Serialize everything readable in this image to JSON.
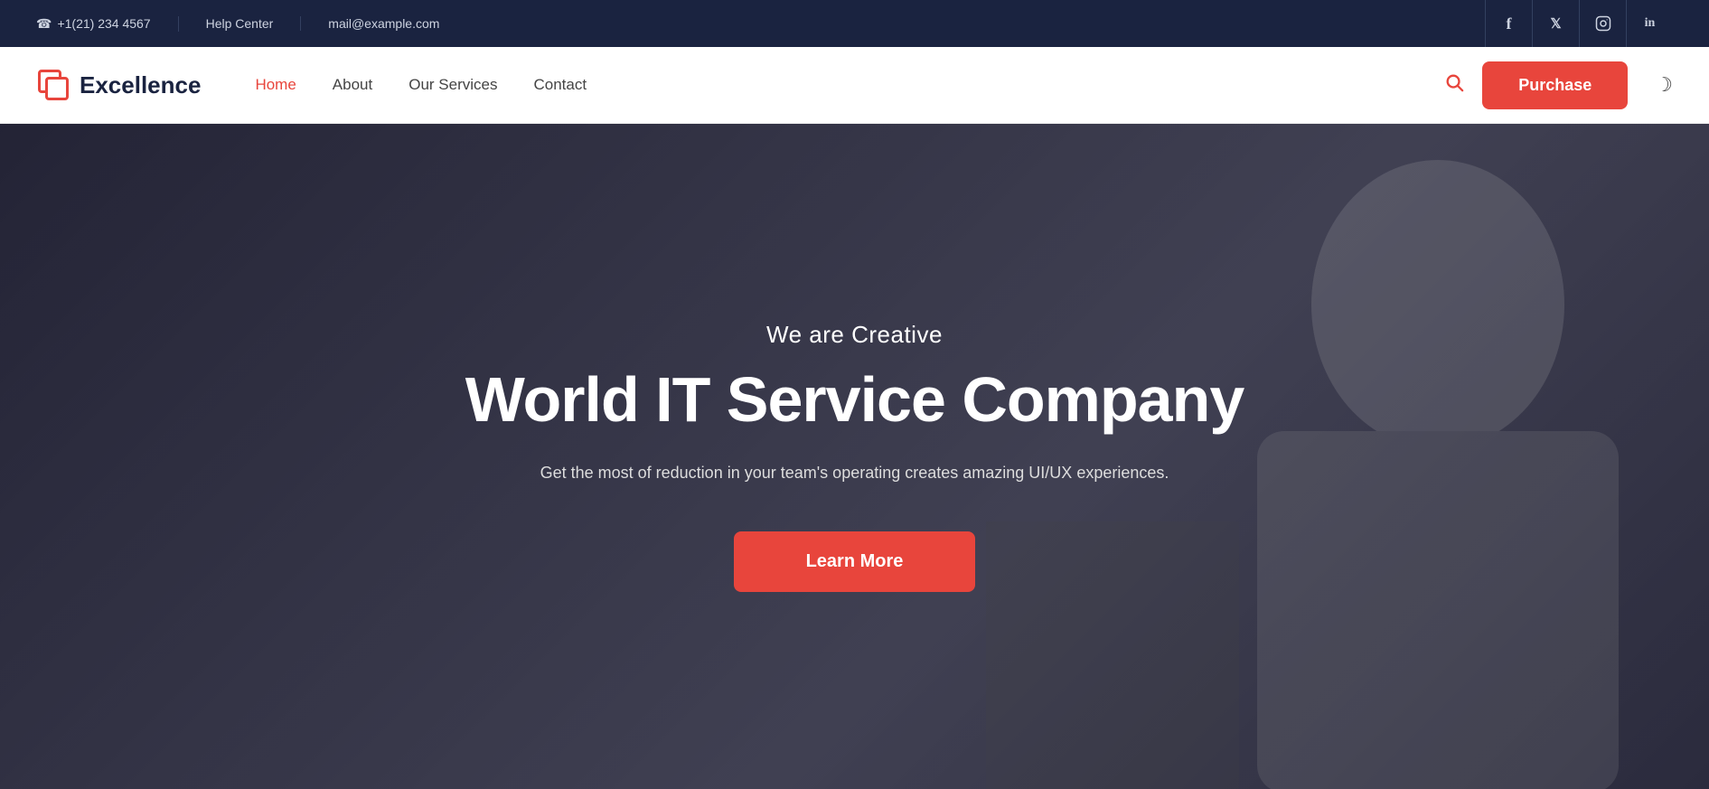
{
  "topbar": {
    "phone": "+1(21) 234 4567",
    "phone_icon": "☎",
    "help_center": "Help Center",
    "email": "mail@example.com",
    "socials": [
      {
        "name": "facebook",
        "icon": "f",
        "label": "Facebook"
      },
      {
        "name": "twitter",
        "icon": "𝕏",
        "label": "Twitter"
      },
      {
        "name": "instagram",
        "icon": "📷",
        "label": "Instagram"
      },
      {
        "name": "linkedin",
        "icon": "in",
        "label": "LinkedIn"
      }
    ]
  },
  "header": {
    "logo_text": "Excellence",
    "nav": [
      {
        "label": "Home",
        "active": true
      },
      {
        "label": "About",
        "active": false
      },
      {
        "label": "Our Services",
        "active": false
      },
      {
        "label": "Contact",
        "active": false
      }
    ],
    "purchase_label": "Purchase",
    "search_placeholder": "Search..."
  },
  "hero": {
    "subtitle": "We are Creative",
    "title": "World IT Service Company",
    "description": "Get the most of reduction in your team's operating creates amazing UI/UX experiences.",
    "cta_label": "Learn More"
  },
  "colors": {
    "accent": "#e8453c",
    "dark_bg": "#1a2340",
    "white": "#ffffff"
  }
}
